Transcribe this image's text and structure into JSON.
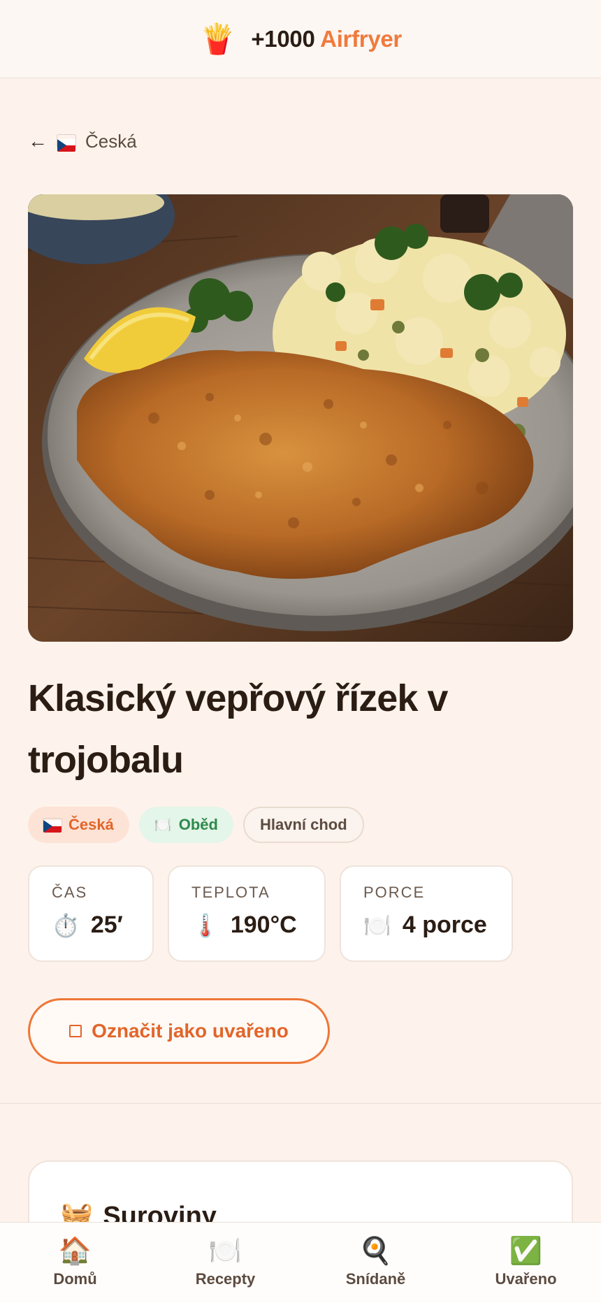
{
  "header": {
    "logo_icon": "🍟",
    "brand_number": "+1000",
    "brand_accent": "Airfryer"
  },
  "breadcrumb": {
    "back_icon": "←",
    "label": "Česká"
  },
  "recipe": {
    "title": "Klasický vepřový řízek v trojobalu",
    "tags": {
      "cuisine": "Česká",
      "meal_icon": "🍽️",
      "meal": "Oběd",
      "course": "Hlavní chod"
    },
    "stats": {
      "time_label": "ČAS",
      "time_icon": "⏱️",
      "time_value": "25′",
      "temp_label": "TEPLOTA",
      "temp_icon": "🌡️",
      "temp_value": "190°C",
      "portions_label": "PORCE",
      "portions_icon": "🍽️",
      "portions_value": "4 porce"
    },
    "cook_button": "Označit jako uvařeno"
  },
  "ingredients": {
    "icon": "🧺",
    "title": "Suroviny"
  },
  "nav": {
    "home_icon": "🏠",
    "home": "Domů",
    "recipes_icon": "🍽️",
    "recipes": "Recepty",
    "breakfast_icon": "🍳",
    "breakfast": "Snídaně",
    "cooked_icon": "✅",
    "cooked": "Uvařeno"
  },
  "colors": {
    "accent": "#f07a3c",
    "background": "#fdf3ec",
    "meal_tag": "#2e8a4a"
  }
}
